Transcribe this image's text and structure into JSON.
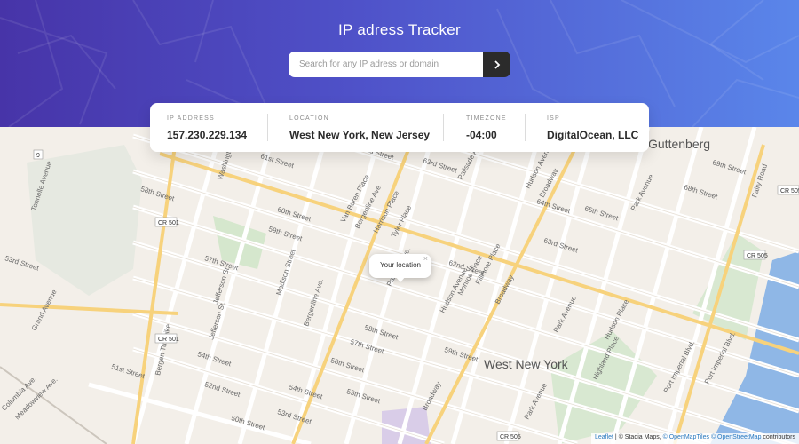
{
  "header": {
    "title": "IP adress Tracker",
    "search_placeholder": "Search for any IP adress or domain",
    "search_value": ""
  },
  "info": {
    "ip_label": "IP ADDRESS",
    "ip_value": "157.230.229.134",
    "location_label": "LOCATION",
    "location_value": "West New York, New Jersey",
    "timezone_label": "TIMEZONE",
    "timezone_value": "-04:00",
    "isp_label": "ISP",
    "isp_value": "DigitalOcean, LLC"
  },
  "popup": {
    "text": "Your location",
    "close": "×"
  },
  "map": {
    "place_labels": [
      "West New York",
      "Guttenberg"
    ],
    "street_labels": [
      "58th Street",
      "60th Street",
      "61st Street",
      "62nd Street",
      "63rd Street",
      "64th Street",
      "65th Street",
      "66th Street",
      "68th Street",
      "69th Street",
      "59th Street",
      "57th Street",
      "56th Street",
      "55th Street",
      "54th Street",
      "53rd Street",
      "52nd Street",
      "51st Street",
      "50th Street",
      "Park Avenue",
      "Hudson Avenue",
      "Palisade Avenue",
      "Bergenline Ave.",
      "Harrison Place",
      "Tyler Place",
      "Madison Street",
      "Jefferson St.",
      "Fillmore Place",
      "Monroe Place",
      "Broadway",
      "Highland Place",
      "Port Imperial Blvd.",
      "Bergen Turnpike",
      "Grand Avenue",
      "Tonnelle Avenue",
      "Meadowview Ave.",
      "Columbia Ave.",
      "Van Buren Place",
      "Washington Street",
      "Hamilton Place",
      "Fairy Road"
    ],
    "route_shields": [
      "CR 501",
      "CR 505",
      "9"
    ],
    "attribution": {
      "leaflet": "Leaflet",
      "stadia": "© Stadia Maps",
      "omt": "© OpenMapTiles",
      "osm": "© OpenStreetMap",
      "suffix": "contributors"
    }
  },
  "colors": {
    "header_start": "#4734a8",
    "header_end": "#5a86ea",
    "search_button": "#2b2b2b",
    "map_land": "#f3efe9",
    "map_water": "#8fb7e6",
    "map_park": "#cfe3c7",
    "major_road": "#f7d27c"
  },
  "icons": {
    "search_button": "chevron-right-icon",
    "location_marker": "popup-pointer"
  }
}
